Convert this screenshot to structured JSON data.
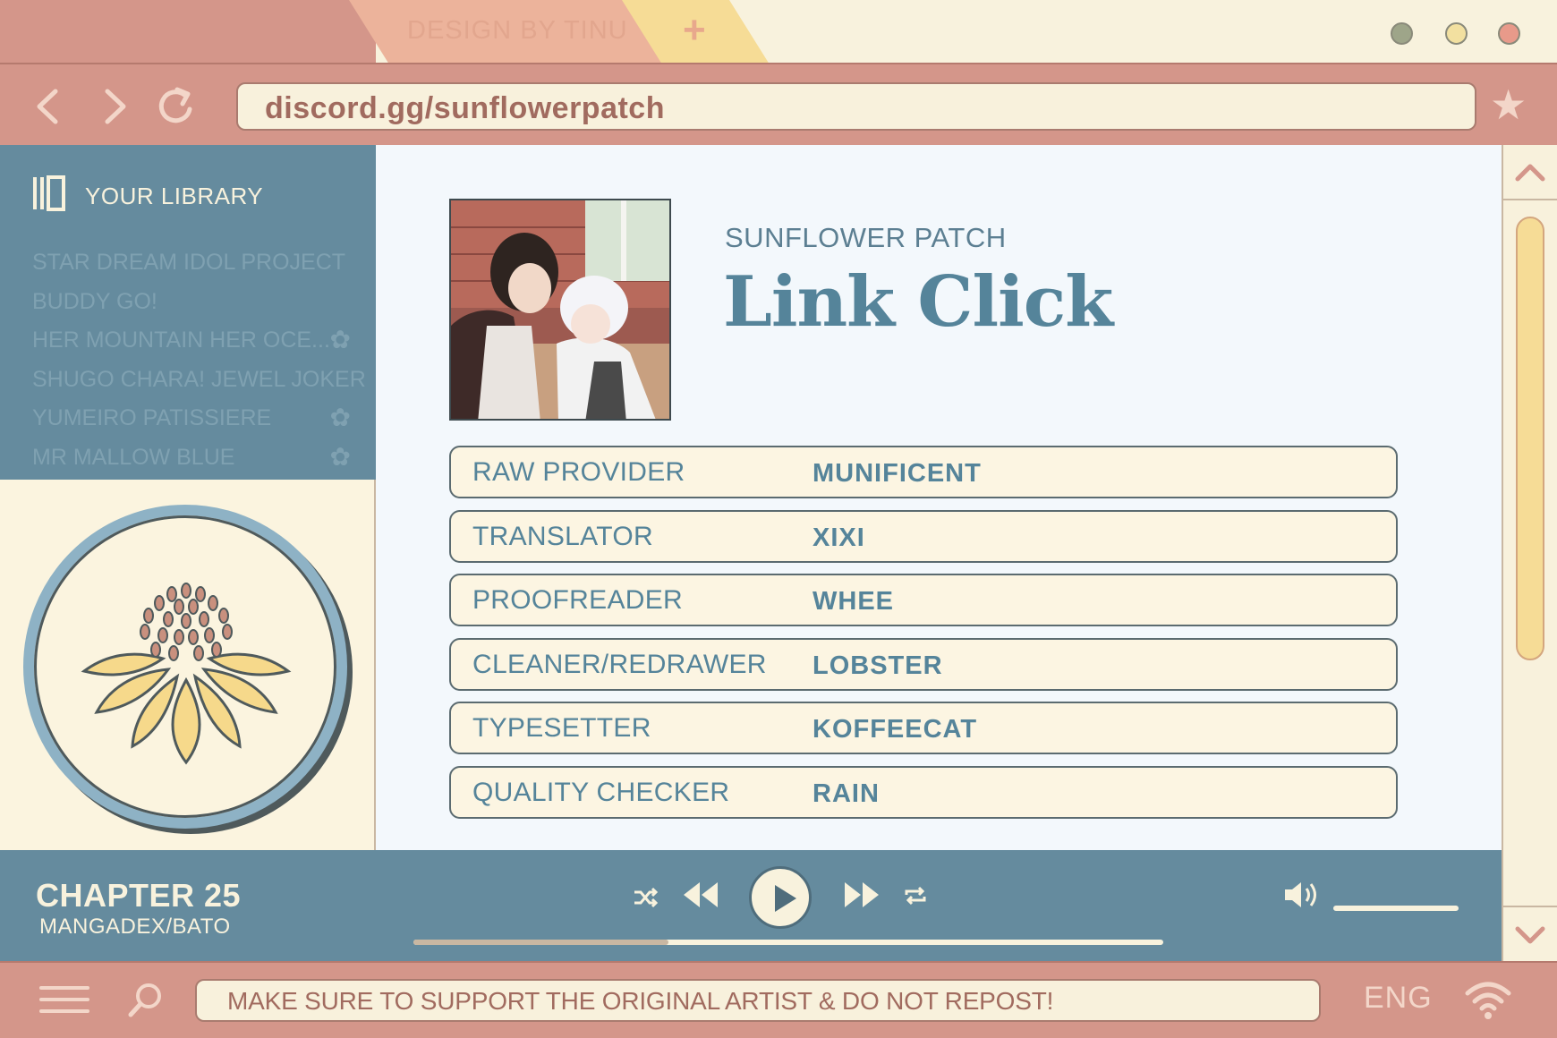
{
  "tabs": {
    "active_label": "DESIGN BY TINU",
    "new_tab_symbol": "+"
  },
  "nav": {
    "back_symbol": "‹",
    "forward_symbol": "›",
    "reload_symbol": "↻",
    "url": "discord.gg/sunflowerpatch",
    "bookmark_symbol": "★"
  },
  "sidebar": {
    "title": "YOUR LIBRARY",
    "items": [
      {
        "label": "STAR DREAM IDOL PROJECT",
        "flower": ""
      },
      {
        "label": "BUDDY GO!",
        "flower": ""
      },
      {
        "label": "HER MOUNTAIN HER OCE...",
        "flower": "✿"
      },
      {
        "label": "SHUGO CHARA! JEWEL JOKER",
        "flower": ""
      },
      {
        "label": "YUMEIRO PATISSIERE",
        "flower": "✿"
      },
      {
        "label": "MR MALLOW BLUE",
        "flower": "✿"
      }
    ]
  },
  "main": {
    "group": "SUNFLOWER PATCH",
    "title": "Link Click",
    "credits": [
      {
        "role": "RAW PROVIDER",
        "name": "MUNIFICENT"
      },
      {
        "role": "TRANSLATOR",
        "name": "XIXI"
      },
      {
        "role": "PROOFREADER",
        "name": "WHEE"
      },
      {
        "role": "CLEANER/REDRAWER",
        "name": "LOBSTER"
      },
      {
        "role": "TYPESETTER",
        "name": "KOFFEECAT"
      },
      {
        "role": "QUALITY CHECKER",
        "name": "RAIN"
      }
    ]
  },
  "player": {
    "chapter": "CHAPTER 25",
    "source": "MANGADEX/BATO",
    "progress": 0.34,
    "volume": 1.0
  },
  "scroll": {
    "up_symbol": "︿",
    "down_symbol": "﹀"
  },
  "taskbar": {
    "notice": "MAKE SURE TO SUPPORT THE ORIGINAL ARTIST & DO NOT REPOST!",
    "language": "ENG"
  },
  "icons": {
    "library": "library-icon",
    "flower": "flower-icon",
    "shuffle": "shuffle-icon",
    "rewind": "rewind-icon",
    "play": "play-icon",
    "fast_forward": "fast-forward-icon",
    "repeat": "repeat-icon",
    "volume": "volume-icon",
    "menu": "menu-icon",
    "search": "search-icon",
    "wifi": "wifi-icon"
  },
  "colors": {
    "frame_pink": "#d4968a",
    "cream": "#f8f2dd",
    "slate_blue": "#658b9e",
    "title_blue": "#55849a",
    "sunflower_yellow": "#f6dc96"
  }
}
